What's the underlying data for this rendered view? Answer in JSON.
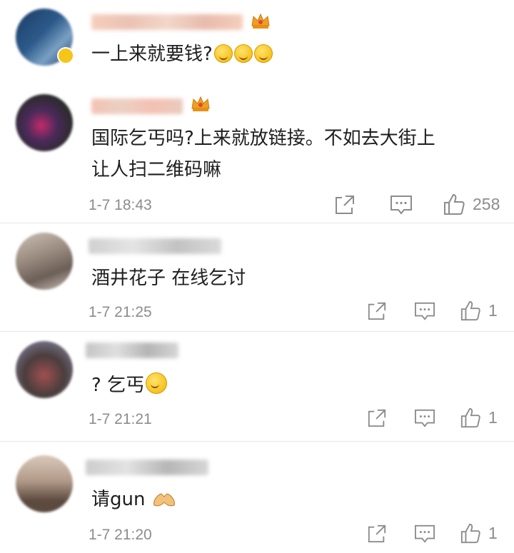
{
  "comments": [
    {
      "text": "一上来就要钱?",
      "emoji_count": 3,
      "avatar_colors": [
        "#2c5a8a",
        "#7aa0c4",
        "#1d3c66"
      ]
    },
    {
      "text_line1": "国际乞丐吗?上来就放链接。不如去大街上",
      "text_line2": "让人扫二维码嘛",
      "date": "1-7 18:43",
      "likes": "258",
      "avatar_colors": [
        "#c22a6a",
        "#2b2b2b",
        "#4a2a5a"
      ]
    },
    {
      "text": "酒井花子 在线乞讨",
      "date": "1-7 21:25",
      "likes": "1",
      "avatar_colors": [
        "#9b8c80",
        "#6c5f57",
        "#cbbfb6"
      ]
    },
    {
      "text": "? 乞丐",
      "date": "1-7 21:21",
      "likes": "1",
      "avatar_colors": [
        "#4a3d3d",
        "#a05050",
        "#7a7a90"
      ]
    },
    {
      "text": "请gun",
      "date": "1-7 21:20",
      "likes": "1",
      "avatar_colors": [
        "#b29a8a",
        "#5c4a3e",
        "#d9c9b9"
      ]
    }
  ],
  "icons": {
    "share": "share-icon",
    "comment": "comment-icon",
    "like": "thumbs-up-icon",
    "crown": "crown-icon",
    "emoji": "grin-emoji-icon",
    "hands": "hands-emoji-icon"
  },
  "colors": {
    "meta": "#8c8c8c",
    "crown": "#f0a020",
    "divider": "#e6e6e6"
  }
}
